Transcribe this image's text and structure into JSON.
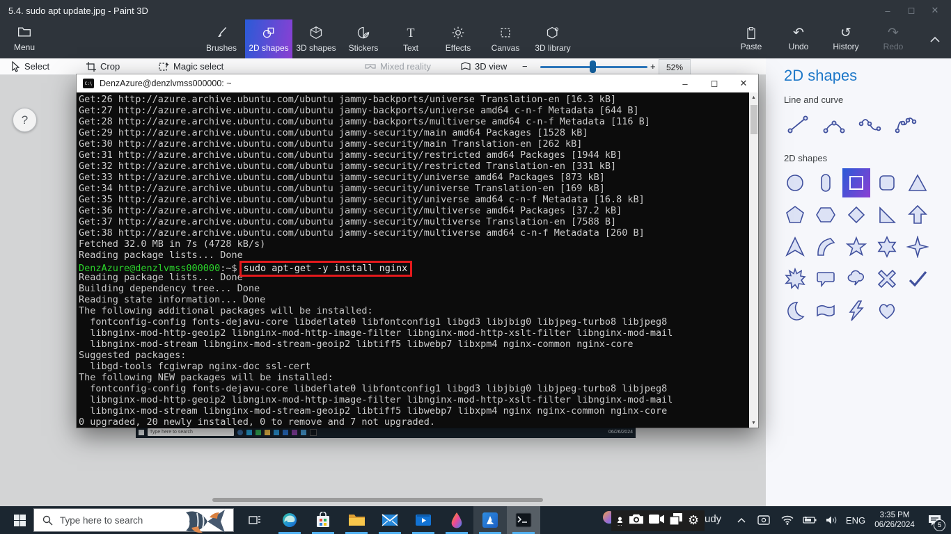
{
  "window": {
    "title": "5.4. sudo apt update.jpg - Paint 3D"
  },
  "top_toolbar": {
    "menu_label": "Menu",
    "tabs": [
      {
        "label": "Brushes"
      },
      {
        "label": "2D shapes"
      },
      {
        "label": "3D shapes"
      },
      {
        "label": "Stickers"
      },
      {
        "label": "Text"
      },
      {
        "label": "Effects"
      },
      {
        "label": "Canvas"
      },
      {
        "label": "3D library"
      }
    ],
    "active_tab": "2D shapes",
    "actions": [
      {
        "label": "Paste"
      },
      {
        "label": "Undo"
      },
      {
        "label": "History"
      },
      {
        "label": "Redo",
        "disabled": true
      }
    ]
  },
  "edit_toolbar": {
    "select_label": "Select",
    "crop_label": "Crop",
    "magic_select_label": "Magic select",
    "mixed_reality_label": "Mixed reality",
    "threed_view_label": "3D view",
    "zoom_percent": "52%"
  },
  "canvas": {
    "help_glyph": "?"
  },
  "terminal": {
    "title": "DenzAzure@denzlvmss000000: ~",
    "lines_before": [
      "Get:26 http://azure.archive.ubuntu.com/ubuntu jammy-backports/universe Translation-en [16.3 kB]",
      "Get:27 http://azure.archive.ubuntu.com/ubuntu jammy-backports/universe amd64 c-n-f Metadata [644 B]",
      "Get:28 http://azure.archive.ubuntu.com/ubuntu jammy-backports/multiverse amd64 c-n-f Metadata [116 B]",
      "Get:29 http://azure.archive.ubuntu.com/ubuntu jammy-security/main amd64 Packages [1528 kB]",
      "Get:30 http://azure.archive.ubuntu.com/ubuntu jammy-security/main Translation-en [262 kB]",
      "Get:31 http://azure.archive.ubuntu.com/ubuntu jammy-security/restricted amd64 Packages [1944 kB]",
      "Get:32 http://azure.archive.ubuntu.com/ubuntu jammy-security/restricted Translation-en [331 kB]",
      "Get:33 http://azure.archive.ubuntu.com/ubuntu jammy-security/universe amd64 Packages [873 kB]",
      "Get:34 http://azure.archive.ubuntu.com/ubuntu jammy-security/universe Translation-en [169 kB]",
      "Get:35 http://azure.archive.ubuntu.com/ubuntu jammy-security/universe amd64 c-n-f Metadata [16.8 kB]",
      "Get:36 http://azure.archive.ubuntu.com/ubuntu jammy-security/multiverse amd64 Packages [37.2 kB]",
      "Get:37 http://azure.archive.ubuntu.com/ubuntu jammy-security/multiverse Translation-en [7588 B]",
      "Get:38 http://azure.archive.ubuntu.com/ubuntu jammy-security/multiverse amd64 c-n-f Metadata [260 B]",
      "Fetched 32.0 MB in 7s (4728 kB/s)",
      "Reading package lists... Done"
    ],
    "prompt_user": "DenzAzure@denzlvmss000000",
    "prompt_suffix": ":~$",
    "command": "sudo apt-get -y install nginx",
    "lines_after": [
      "Reading package lists... Done",
      "Building dependency tree... Done",
      "Reading state information... Done",
      "The following additional packages will be installed:",
      "  fontconfig-config fonts-dejavu-core libdeflate0 libfontconfig1 libgd3 libjbig0 libjpeg-turbo8 libjpeg8",
      "  libnginx-mod-http-geoip2 libnginx-mod-http-image-filter libnginx-mod-http-xslt-filter libnginx-mod-mail",
      "  libnginx-mod-stream libnginx-mod-stream-geoip2 libtiff5 libwebp7 libxpm4 nginx-common nginx-core",
      "Suggested packages:",
      "  libgd-tools fcgiwrap nginx-doc ssl-cert",
      "The following NEW packages will be installed:",
      "  fontconfig-config fonts-dejavu-core libdeflate0 libfontconfig1 libgd3 libjbig0 libjpeg-turbo8 libjpeg8",
      "  libnginx-mod-http-geoip2 libnginx-mod-http-image-filter libnginx-mod-http-xslt-filter libnginx-mod-mail",
      "  libnginx-mod-stream libnginx-mod-stream-geoip2 libtiff5 libwebp7 libxpm4 nginx nginx-common nginx-core",
      "0 upgraded, 20 newly installed, 0 to remove and 7 not upgraded."
    ]
  },
  "panel": {
    "title": "2D shapes",
    "line_curve_label": "Line and curve",
    "line_curve_icons": [
      "line",
      "curve",
      "double-curve",
      "multi-curve"
    ],
    "shapes_label": "2D shapes",
    "selected_shape": "square",
    "shapes": [
      "circle",
      "ellipse",
      "square",
      "rounded-square",
      "triangle",
      "pentagon",
      "hexagon",
      "diamond",
      "right-triangle",
      "arrow-up",
      "arrowhead",
      "curved-swoosh",
      "five-point-star",
      "six-point-star",
      "four-point-star",
      "burst",
      "speech-bubble",
      "thought-bubble",
      "cross",
      "checkmark",
      "crescent",
      "banner",
      "lightning",
      "heart"
    ]
  },
  "taskbar": {
    "search_placeholder": "Type here to search",
    "partial_text": "udy",
    "language": "ENG",
    "time": "3:35 PM",
    "date": "06/26/2024",
    "notification_count": "5"
  },
  "embedded_screenshot": {
    "search_text": "Type here to search",
    "date_text": "06/26/2024"
  },
  "colors": {
    "accent_gradient_start": "#2a5bd7",
    "accent_gradient_end": "#8c3fd3",
    "prompt_green": "#2bd42b",
    "annotation_red": "#e3191c",
    "taskbar_bg": "#1b2630",
    "running_underline": "#51b0f0",
    "panel_heading_blue": "#1e78c8"
  }
}
